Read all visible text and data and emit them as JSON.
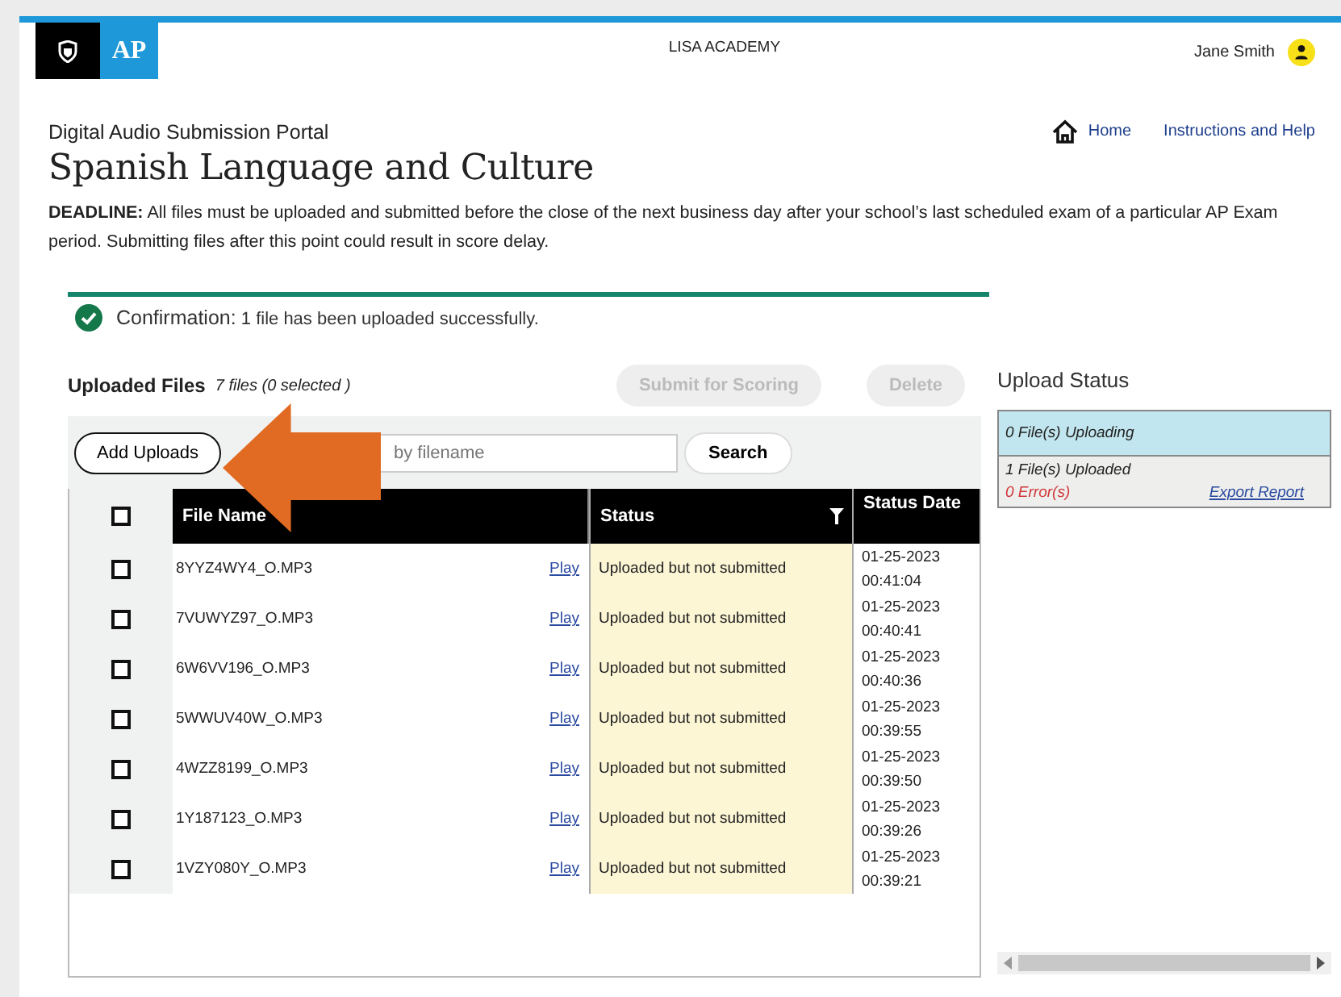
{
  "header": {
    "logo": "AP",
    "school": "LISA ACADEMY",
    "user": "Jane Smith"
  },
  "portal": "Digital Audio Submission Portal",
  "nav": [
    {
      "label": "Home",
      "kind": "home"
    },
    {
      "label": "Instructions and Help",
      "kind": "link"
    }
  ],
  "title": "Spanish Language and Culture",
  "deadline": "**DEADLINE:** All files must be uploaded and submitted before the close of the next business day after your school’s last scheduled exam of a particular AP Exam period. Submitting files after this point could result in score delay.",
  "confirmation": {
    "label": "Confirmation:",
    "message": "1 file has been uploaded successfully."
  },
  "files": {
    "title": "Uploaded Files",
    "count": "7 files (0 selected )",
    "buttons": [
      {
        "label": "Submit for Scoring",
        "disabled": true
      },
      {
        "label": "Delete",
        "disabled": true
      }
    ],
    "add_button": "Add Uploads",
    "search": {
      "placeholder": "by filename",
      "button": "Search"
    },
    "select_all": {
      "checked": false
    },
    "columns": [
      "File Name",
      "Status",
      "Status Date"
    ],
    "rows": [
      {
        "checked": false,
        "name": "8YYZ4WY4_O.MP3",
        "action": "Play",
        "status": "Uploaded but not submitted",
        "date": "01-25-2023",
        "time": "00:41:04"
      },
      {
        "checked": false,
        "name": "7VUWYZ97_O.MP3",
        "action": "Play",
        "status": "Uploaded but not submitted",
        "date": "01-25-2023",
        "time": "00:40:41"
      },
      {
        "checked": false,
        "name": "6W6VV196_O.MP3",
        "action": "Play",
        "status": "Uploaded but not submitted",
        "date": "01-25-2023",
        "time": "00:40:36"
      },
      {
        "checked": false,
        "name": "5WWUV40W_O.MP3",
        "action": "Play",
        "status": "Uploaded but not submitted",
        "date": "01-25-2023",
        "time": "00:39:55"
      },
      {
        "checked": false,
        "name": "4WZZ8199_O.MP3",
        "action": "Play",
        "status": "Uploaded but not submitted",
        "date": "01-25-2023",
        "time": "00:39:50"
      },
      {
        "checked": false,
        "name": "1Y187123_O.MP3",
        "action": "Play",
        "status": "Uploaded but not submitted",
        "date": "01-25-2023",
        "time": "00:39:26"
      },
      {
        "checked": false,
        "name": "1VZY080Y_O.MP3",
        "action": "Play",
        "status": "Uploaded but not submitted",
        "date": "01-25-2023",
        "time": "00:39:21"
      }
    ]
  },
  "upload_status": {
    "title": "Upload Status",
    "uploading": "0 File(s) Uploading",
    "uploaded": "1 File(s) Uploaded",
    "errors": "0 Error(s)",
    "export": "Export Report"
  }
}
